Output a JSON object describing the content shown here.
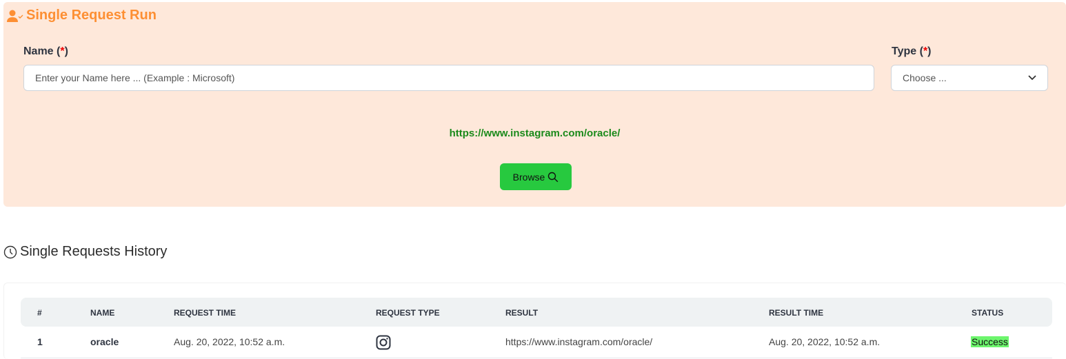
{
  "run": {
    "title": "Single Request Run",
    "name_label": "Name (",
    "type_label": "Type (",
    "required_mark": "*",
    "close_paren": ")",
    "name_placeholder": "Enter your Name here ... (Example : Microsoft)",
    "type_value": "Choose ...",
    "result_link": "https://www.instagram.com/oracle/",
    "browse_label": "Browse"
  },
  "history": {
    "title": "Single Requests History",
    "columns": [
      "#",
      "NAME",
      "REQUEST TIME",
      "REQUEST TYPE",
      "RESULT",
      "RESULT TIME",
      "STATUS"
    ],
    "rows": [
      {
        "index": "1",
        "name": "oracle",
        "request_time": "Aug. 20, 2022, 10:52 a.m.",
        "request_type": "instagram-icon",
        "result": "https://www.instagram.com/oracle/",
        "result_time": "Aug. 20, 2022, 10:52 a.m.",
        "status": "Success"
      }
    ]
  }
}
